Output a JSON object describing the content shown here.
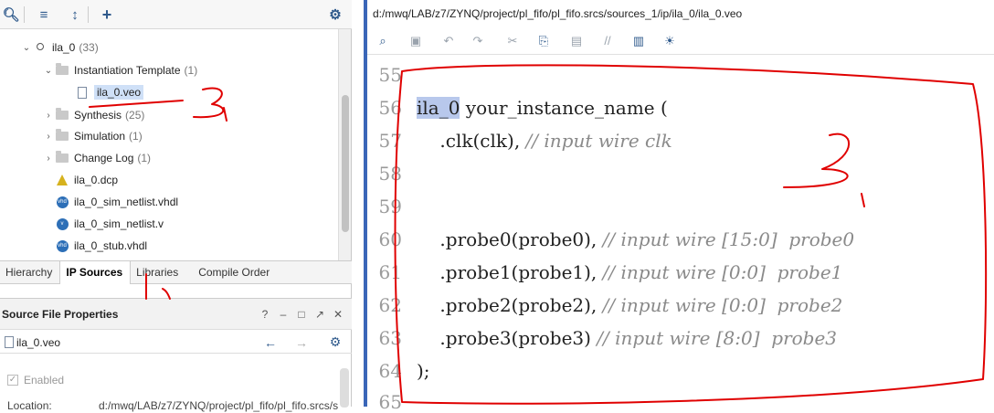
{
  "left": {
    "toolbar": {
      "icons": [
        "search-icon",
        "collapse-all-icon",
        "expand-all-icon",
        "add-icon",
        "gear-icon"
      ]
    },
    "tree": {
      "root": {
        "label": "ila_0",
        "count": "(33)"
      },
      "items": [
        {
          "label": "Instantiation Template",
          "count": "(1)"
        },
        {
          "label": "ila_0.veo",
          "count": ""
        },
        {
          "label": "Synthesis",
          "count": "(25)"
        },
        {
          "label": "Simulation",
          "count": "(1)"
        },
        {
          "label": "Change Log",
          "count": "(1)"
        },
        {
          "label": "ila_0.dcp",
          "count": ""
        },
        {
          "label": "ila_0_sim_netlist.vhdl",
          "count": ""
        },
        {
          "label": "ila_0_sim_netlist.v",
          "count": ""
        },
        {
          "label": "ila_0_stub.vhdl",
          "count": ""
        }
      ]
    },
    "tabs": [
      {
        "label": "Hierarchy"
      },
      {
        "label": "IP Sources"
      },
      {
        "label": "Libraries"
      },
      {
        "label": "Compile Order"
      }
    ],
    "props": {
      "title": "Source File Properties",
      "help": "?",
      "file": "ila_0.veo",
      "enabled_label": "Enabled",
      "location_label": "Location:",
      "location_value": "d:/mwq/LAB/z7/ZYNQ/project/pl_fifo/pl_fifo.srcs/s"
    }
  },
  "right": {
    "path": "d:/mwq/LAB/z7/ZYNQ/project/pl_fifo/pl_fifo.srcs/sources_1/ip/ila_0/ila_0.veo",
    "lines": [
      {
        "num": "55",
        "code": "",
        "comment": ""
      },
      {
        "num": "56",
        "hl": "ila_0",
        "code": " your_instance_name (",
        "comment": ""
      },
      {
        "num": "57",
        "code": "    .clk(clk), ",
        "comment": "// input wire clk"
      },
      {
        "num": "58",
        "code": "",
        "comment": ""
      },
      {
        "num": "59",
        "code": "",
        "comment": ""
      },
      {
        "num": "60",
        "code": "    .probe0(probe0), ",
        "comment": "// input wire [15:0]  probe0"
      },
      {
        "num": "61",
        "code": "    .probe1(probe1), ",
        "comment": "// input wire [0:0]  probe1"
      },
      {
        "num": "62",
        "code": "    .probe2(probe2), ",
        "comment": "// input wire [0:0]  probe2"
      },
      {
        "num": "63",
        "code": "    .probe3(probe3) ",
        "comment": "// input wire [8:0]  probe3"
      },
      {
        "num": "64",
        "code": ");",
        "comment": ""
      },
      {
        "num": "65",
        "code": "",
        "comment": ""
      }
    ]
  },
  "colors": {
    "accent": "#3a66b8",
    "annotation": "#e00000",
    "selection": "#cfe0f7"
  }
}
